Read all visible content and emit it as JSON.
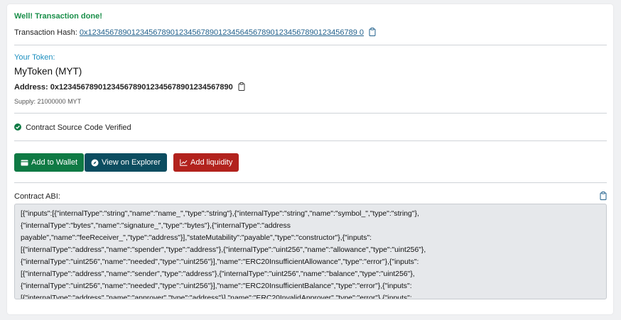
{
  "transaction": {
    "status": "Well! Transaction done!",
    "hash_label": "Transaction Hash:",
    "hash_value": "0x12345678901234567890123456789012345645678901234567890123456789 0"
  },
  "token": {
    "section_label": "Your Token:",
    "name": "MyToken (MYT)",
    "address_label": "Address:",
    "address_value": "0x1234567890123456789012345678901234567890",
    "supply": "Supply: 21000000 MYT"
  },
  "verification": {
    "text": "Contract Source Code Verified"
  },
  "actions": {
    "add_wallet": "Add to Wallet",
    "view_explorer": "View on Explorer",
    "add_liquidity": "Add liquidity"
  },
  "abi": {
    "label": "Contract ABI:",
    "lines": [
      "[{\"inputs\":[{\"internalType\":\"string\",\"name\":\"name_\",\"type\":\"string\"},{\"internalType\":\"string\",\"name\":\"symbol_\",\"type\":\"string\"},",
      "{\"internalType\":\"bytes\",\"name\":\"signature_\",\"type\":\"bytes\"},{\"internalType\":\"address",
      "payable\",\"name\":\"feeReceiver_\",\"type\":\"address\"}],\"stateMutability\":\"payable\",\"type\":\"constructor\"},{\"inputs\":",
      "[{\"internalType\":\"address\",\"name\":\"spender\",\"type\":\"address\"},{\"internalType\":\"uint256\",\"name\":\"allowance\",\"type\":\"uint256\"},",
      "{\"internalType\":\"uint256\",\"name\":\"needed\",\"type\":\"uint256\"}],\"name\":\"ERC20InsufficientAllowance\",\"type\":\"error\"},{\"inputs\":",
      "[{\"internalType\":\"address\",\"name\":\"sender\",\"type\":\"address\"},{\"internalType\":\"uint256\",\"name\":\"balance\",\"type\":\"uint256\"},",
      "{\"internalType\":\"uint256\",\"name\":\"needed\",\"type\":\"uint256\"}],\"name\":\"ERC20InsufficientBalance\",\"type\":\"error\"},{\"inputs\":",
      "[{\"internalType\":\"address\",\"name\":\"approver\",\"type\":\"address\"}],\"name\":\"ERC20InvalidApprover\",\"type\":\"error\"},{\"inputs\":"
    ]
  }
}
